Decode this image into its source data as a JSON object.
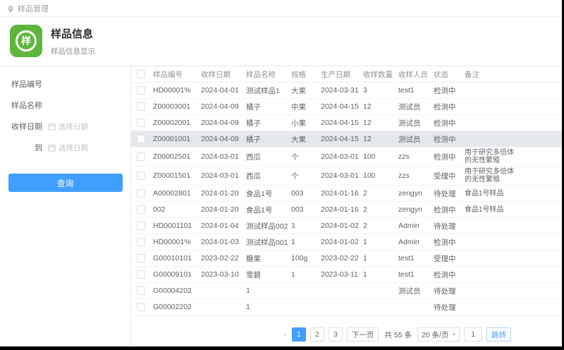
{
  "topbar": {
    "breadcrumb": "样品管理"
  },
  "header": {
    "icon_text": "样",
    "title": "样品信息",
    "subtitle": "样品信息显示"
  },
  "sidebar": {
    "fields": [
      {
        "label": "样品编号",
        "placeholder": ""
      },
      {
        "label": "样品名称",
        "placeholder": ""
      },
      {
        "label": "收样日期",
        "placeholder": "选择日期"
      },
      {
        "label": "到",
        "placeholder": "选择日期"
      }
    ],
    "query_button": "查询"
  },
  "table": {
    "columns": [
      "样品编号",
      "收样日期",
      "样品名称",
      "规格",
      "生产日期",
      "收样数量",
      "收样人员",
      "状态",
      "备注"
    ],
    "rows": [
      {
        "id": "HD00001%",
        "receive_date": "2024-04-01",
        "name": "测试样品1",
        "spec": "大果",
        "prod_date": "2024-03-31",
        "qty": "3",
        "receiver": "test1",
        "status": "检测中",
        "remark": "",
        "highlighted": false
      },
      {
        "id": "Z00003001",
        "receive_date": "2024-04-09",
        "name": "橘子",
        "spec": "中果",
        "prod_date": "2024-04-15",
        "qty": "12",
        "receiver": "测试员",
        "status": "检测中",
        "remark": "",
        "highlighted": false
      },
      {
        "id": "Z00002001",
        "receive_date": "2024-04-09",
        "name": "橘子",
        "spec": "小果",
        "prod_date": "2024-04-15",
        "qty": "12",
        "receiver": "测试员",
        "status": "检测中",
        "remark": "",
        "highlighted": false
      },
      {
        "id": "Z00001001",
        "receive_date": "2024-04-09",
        "name": "橘子",
        "spec": "大果",
        "prod_date": "2024-04-15",
        "qty": "12",
        "receiver": "测试员",
        "status": "检测中",
        "remark": "",
        "highlighted": true
      },
      {
        "id": "Z00002501",
        "receive_date": "2024-03-01",
        "name": "西瓜",
        "spec": "个",
        "prod_date": "2024-03-01",
        "qty": "100",
        "receiver": "zzs",
        "status": "检测中",
        "remark": "用于研究多倍体的无性繁殖",
        "highlighted": false
      },
      {
        "id": "Z00001501",
        "receive_date": "2024-03-01",
        "name": "西瓜",
        "spec": "个",
        "prod_date": "2024-03-01",
        "qty": "100",
        "receiver": "zzs",
        "status": "受理中",
        "remark": "用于研究多倍体的无性繁殖",
        "highlighted": false
      },
      {
        "id": "A00002801",
        "receive_date": "2024-01-20",
        "name": "食品1号",
        "spec": "003",
        "prod_date": "2024-01-16",
        "qty": "2",
        "receiver": "zengyn",
        "status": "待处理",
        "remark": "食品1号样品",
        "highlighted": false
      },
      {
        "id": "002",
        "receive_date": "2024-01-20",
        "name": "食品1号",
        "spec": "003",
        "prod_date": "2024-01-16",
        "qty": "2",
        "receiver": "zengyn",
        "status": "检测中",
        "remark": "食品1号样品",
        "highlighted": false
      },
      {
        "id": "HD0001101",
        "receive_date": "2024-01-04",
        "name": "测试样品002",
        "spec": "1",
        "prod_date": "2024-01-02",
        "qty": "2",
        "receiver": "Admin",
        "status": "待处理",
        "remark": "",
        "highlighted": false
      },
      {
        "id": "HD00001%",
        "receive_date": "2024-01-03",
        "name": "测试样品001",
        "spec": "1",
        "prod_date": "2024-01-02",
        "qty": "1",
        "receiver": "Admin",
        "status": "检测中",
        "remark": "",
        "highlighted": false
      },
      {
        "id": "G00010101",
        "receive_date": "2023-02-22",
        "name": "糖果",
        "spec": "100g",
        "prod_date": "2023-02-22",
        "qty": "1",
        "receiver": "test1",
        "status": "受理中",
        "remark": "",
        "highlighted": false
      },
      {
        "id": "G00009101",
        "receive_date": "2023-03-10",
        "name": "雪碧",
        "spec": "1",
        "prod_date": "2023-03-11",
        "qty": "1",
        "receiver": "test1",
        "status": "检测中",
        "remark": "",
        "highlighted": false
      },
      {
        "id": "G00004202",
        "receive_date": "",
        "name": "1",
        "spec": "",
        "prod_date": "",
        "qty": "",
        "receiver": "测试员",
        "status": "待处理",
        "remark": "",
        "highlighted": false
      },
      {
        "id": "G00002202",
        "receive_date": "",
        "name": "1",
        "spec": "",
        "prod_date": "",
        "qty": "",
        "receiver": "",
        "status": "待处理",
        "remark": "",
        "highlighted": false
      }
    ]
  },
  "pagination": {
    "prev": "‹",
    "pages": [
      "1",
      "2",
      "3"
    ],
    "active_page": "1",
    "next_label": "下一页",
    "total_text": "共 55 条",
    "page_size": "20 条/页",
    "caret": "▾",
    "jump_value": "1",
    "jump_label": "跳转"
  },
  "colors": {
    "accent": "#409eff",
    "icon_green": "#5eb63c"
  }
}
